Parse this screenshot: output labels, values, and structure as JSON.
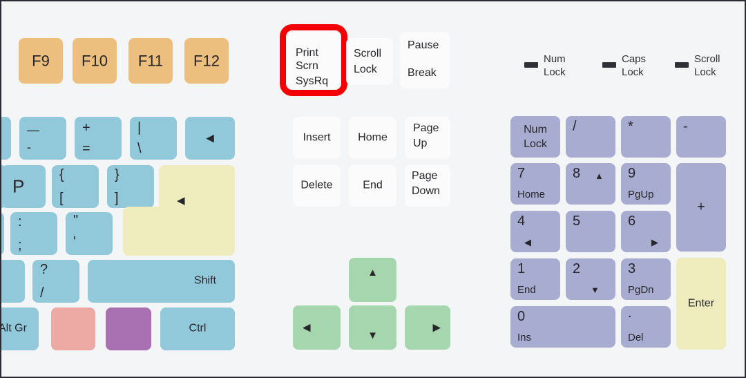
{
  "diagram": {
    "title": "Keyboard layout diagram",
    "background_color": "#f4f5f7",
    "border_color": "#2b2b33"
  },
  "colors": {
    "function_key": "#edbf7f",
    "white_key": "#fbfbfb",
    "blue_key": "#92c9da",
    "yellow_key": "#eeecbc",
    "green_key": "#a6d6ae",
    "numpad_key": "#a9acd1",
    "pink_key": "#eda9a4",
    "violet_key": "#a971b2",
    "highlight_ring": "#f40000",
    "led_indicator": "#303036"
  },
  "function_keys": [
    {
      "label": "F9"
    },
    {
      "label": "F10"
    },
    {
      "label": "F11"
    },
    {
      "label": "F12"
    }
  ],
  "system_keys": [
    {
      "name": "print-screen",
      "line1": "Print",
      "line2": "Scrn",
      "line3": "SysRq",
      "highlighted": true
    },
    {
      "name": "scroll-lock",
      "line1": "Scroll",
      "line2": "Lock",
      "highlighted": false
    },
    {
      "name": "pause-break",
      "line1": "Pause",
      "line2": "Break",
      "highlighted": false
    }
  ],
  "led_indicators": [
    {
      "name": "num-lock",
      "line1": "Num",
      "line2": "Lock"
    },
    {
      "name": "caps-lock",
      "line1": "Caps",
      "line2": "Lock"
    },
    {
      "name": "scroll-lock",
      "line1": "Scroll",
      "line2": "Lock"
    }
  ],
  "main_keys": {
    "number_row": [
      {
        "name": "minus",
        "top": "—",
        "bottom": "-"
      },
      {
        "name": "equals",
        "top": "+",
        "bottom": "="
      },
      {
        "name": "backslash",
        "top": "|",
        "bottom": "\\"
      },
      {
        "name": "backspace",
        "glyph": "◀"
      }
    ],
    "top_row": [
      {
        "name": "p",
        "label": "P"
      },
      {
        "name": "bracket-left",
        "top": "{",
        "bottom": "["
      },
      {
        "name": "bracket-right",
        "top": "}",
        "bottom": "]"
      }
    ],
    "home_row": [
      {
        "name": "semicolon",
        "top": ":",
        "bottom": ";"
      },
      {
        "name": "quote",
        "top": "\"",
        "bottom": "'"
      }
    ],
    "enter_key": {
      "name": "enter",
      "glyph": "◀"
    },
    "bottom_row": [
      {
        "name": "slash",
        "top": "?",
        "bottom": "/"
      },
      {
        "name": "right-shift",
        "label": "Shift"
      }
    ],
    "modifier_row": [
      {
        "name": "alt-gr",
        "label": "Alt Gr"
      },
      {
        "name": "pink-modifier",
        "label": ""
      },
      {
        "name": "violet-modifier",
        "label": ""
      },
      {
        "name": "right-ctrl",
        "label": "Ctrl"
      }
    ]
  },
  "nav_cluster": [
    {
      "name": "insert",
      "label": "Insert"
    },
    {
      "name": "home",
      "label": "Home"
    },
    {
      "name": "page-up",
      "line1": "Page",
      "line2": "Up"
    },
    {
      "name": "delete",
      "label": "Delete"
    },
    {
      "name": "end",
      "label": "End"
    },
    {
      "name": "page-down",
      "line1": "Page",
      "line2": "Down"
    }
  ],
  "arrow_keys": [
    {
      "name": "arrow-up",
      "glyph": "▲"
    },
    {
      "name": "arrow-left",
      "glyph": "◀"
    },
    {
      "name": "arrow-down",
      "glyph": "▼"
    },
    {
      "name": "arrow-right",
      "glyph": "▶"
    }
  ],
  "numpad": {
    "row1": [
      {
        "name": "num-lock",
        "line1": "Num",
        "line2": "Lock"
      },
      {
        "name": "divide",
        "label": "/"
      },
      {
        "name": "multiply",
        "label": "*"
      },
      {
        "name": "subtract",
        "label": "-"
      }
    ],
    "row2": [
      {
        "name": "numpad-7",
        "primary": "7",
        "secondary": "Home"
      },
      {
        "name": "numpad-8",
        "primary": "8",
        "secondary": "",
        "glyph": "▲"
      },
      {
        "name": "numpad-9",
        "primary": "9",
        "secondary": "PgUp"
      }
    ],
    "row3": [
      {
        "name": "numpad-4",
        "primary": "4",
        "secondary": "",
        "glyph": "◀"
      },
      {
        "name": "numpad-5",
        "primary": "5",
        "secondary": ""
      },
      {
        "name": "numpad-6",
        "primary": "6",
        "secondary": "",
        "glyph": "▶"
      }
    ],
    "row4": [
      {
        "name": "numpad-1",
        "primary": "1",
        "secondary": "End"
      },
      {
        "name": "numpad-2",
        "primary": "2",
        "secondary": "",
        "glyph": "▼"
      },
      {
        "name": "numpad-3",
        "primary": "3",
        "secondary": "PgDn"
      }
    ],
    "row5": [
      {
        "name": "numpad-0",
        "primary": "0",
        "secondary": "Ins"
      },
      {
        "name": "numpad-decimal",
        "primary": ".",
        "secondary": "Del"
      }
    ],
    "add": {
      "name": "numpad-add",
      "label": "+"
    },
    "enter": {
      "name": "numpad-enter",
      "label": "Enter"
    }
  }
}
